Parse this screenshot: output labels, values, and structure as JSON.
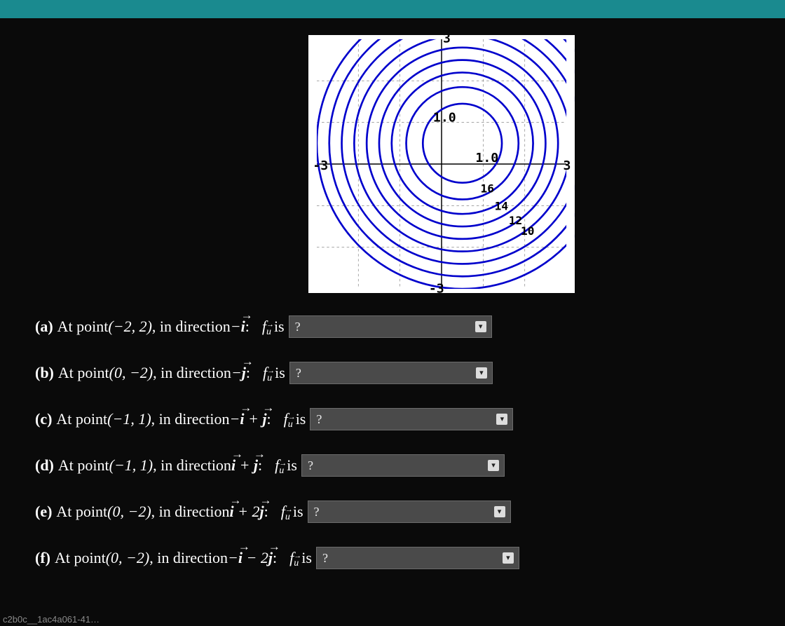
{
  "chart_data": {
    "type": "contour",
    "title": "",
    "xlabel": "",
    "ylabel": "",
    "xlim": [
      -3,
      3
    ],
    "ylim": [
      -3,
      3
    ],
    "x_ticks": [
      -3,
      3
    ],
    "y_ticks": [
      -3,
      3
    ],
    "axis_value_labels": {
      "x_tick_inner": "1.0",
      "y_tick_inner": "1.0"
    },
    "center": [
      0.5,
      0.5
    ],
    "level_labels": [
      {
        "value": 16,
        "pos": [
          1.05,
          -0.55
        ]
      },
      {
        "value": 14,
        "pos": [
          1.35,
          -0.95
        ]
      },
      {
        "value": 12,
        "pos": [
          1.65,
          -1.25
        ]
      },
      {
        "value": 10,
        "pos": [
          1.95,
          -1.5
        ]
      }
    ],
    "rings_radii": [
      0.95,
      1.35,
      1.7,
      2.0,
      2.3,
      2.6,
      2.9,
      3.2,
      3.5
    ]
  },
  "axis": {
    "x_min": "-3",
    "x_max": "3",
    "y_min": "-3",
    "y_max": "3",
    "x_one": "1.0",
    "y_one": "1.0"
  },
  "levels": {
    "l16": "16",
    "l14": "14",
    "l12": "12",
    "l10": "10"
  },
  "questions": {
    "a": {
      "label": "(a)",
      "pre": "At point ",
      "point": "(−2, 2)",
      "mid": ", in direction ",
      "dir_html": "neg_i"
    },
    "b": {
      "label": "(b)",
      "pre": "At point ",
      "point": "(0, −2)",
      "mid": ", in direction ",
      "dir_html": "neg_j"
    },
    "c": {
      "label": "(c)",
      "pre": "At point ",
      "point": "(−1, 1)",
      "mid": ", in direction ",
      "dir_html": "neg_i_plus_j"
    },
    "d": {
      "label": "(d)",
      "pre": "At point ",
      "point": "(−1, 1)",
      "mid": ", in direction ",
      "dir_html": "i_plus_j"
    },
    "e": {
      "label": "(e)",
      "pre": "At point ",
      "point": "(0, −2)",
      "mid": ", in direction ",
      "dir_html": "i_plus_2j"
    },
    "f": {
      "label": "(f)",
      "pre": "At point ",
      "point": "(0, −2)",
      "mid": ", in direction ",
      "dir_html": "neg_i_minus_2j"
    }
  },
  "common": {
    "colon": ":",
    "f": "f",
    "u": "u",
    "is": "is",
    "placeholder": "?"
  },
  "direction_fragments": {
    "minus": "−",
    "plus": " + ",
    "minus_sp": " − ",
    "i": "i",
    "j": "j",
    "two": "2",
    "arrow": "→"
  },
  "footer": "c2b0c__1ac4a061-41…"
}
